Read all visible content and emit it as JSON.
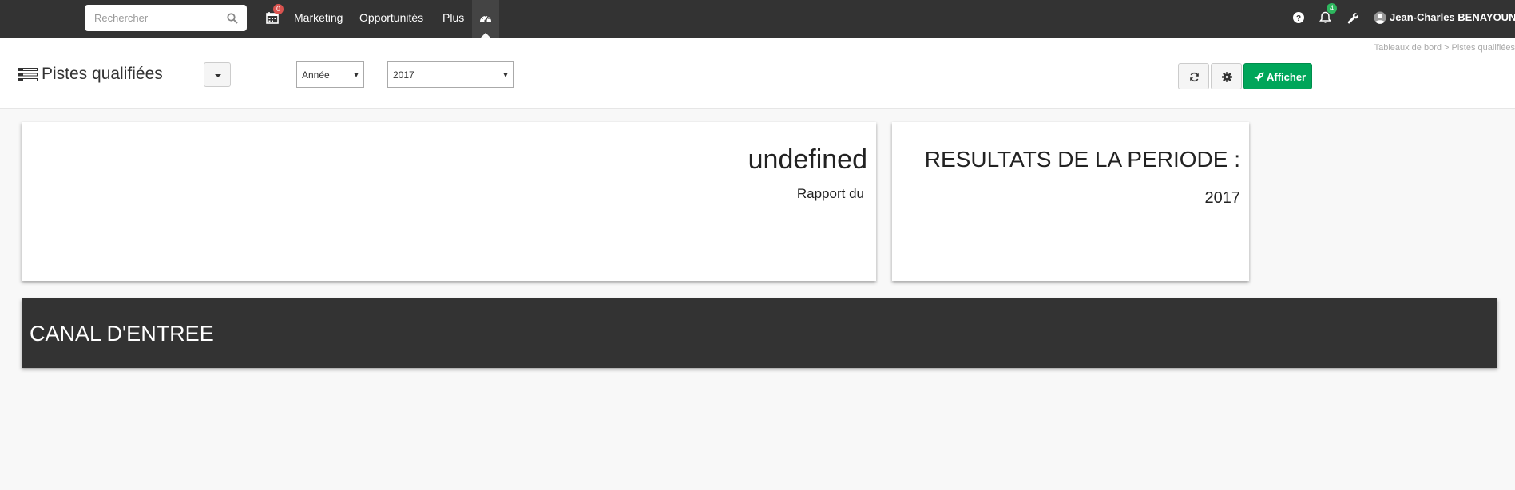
{
  "topbar": {
    "search": {
      "placeholder": "Rechercher",
      "value": ""
    },
    "calendar_badge": "0",
    "nav_links": [
      "Marketing",
      "Opportunités",
      "Plus"
    ],
    "notifications_badge": "4",
    "user_name": "Jean-Charles BENAYOUN"
  },
  "header": {
    "breadcrumb": "Tableaux de bord  > Pistes qualifiées",
    "page_title": "Pistes qualifiées",
    "period_type": "Année",
    "period_value": "2017",
    "submit_label": "Afficher"
  },
  "card_report": {
    "value": "undefined",
    "subtitle": "Rapport du"
  },
  "card_results": {
    "title": "RESULTATS DE LA PERIODE :",
    "year": "2017"
  },
  "section": {
    "title": "CANAL D'ENTREE"
  },
  "colors": {
    "topbar": "#333333",
    "accent_green": "#00a65a",
    "badge_red": "#d9534f",
    "badge_green": "#2eb75e"
  }
}
